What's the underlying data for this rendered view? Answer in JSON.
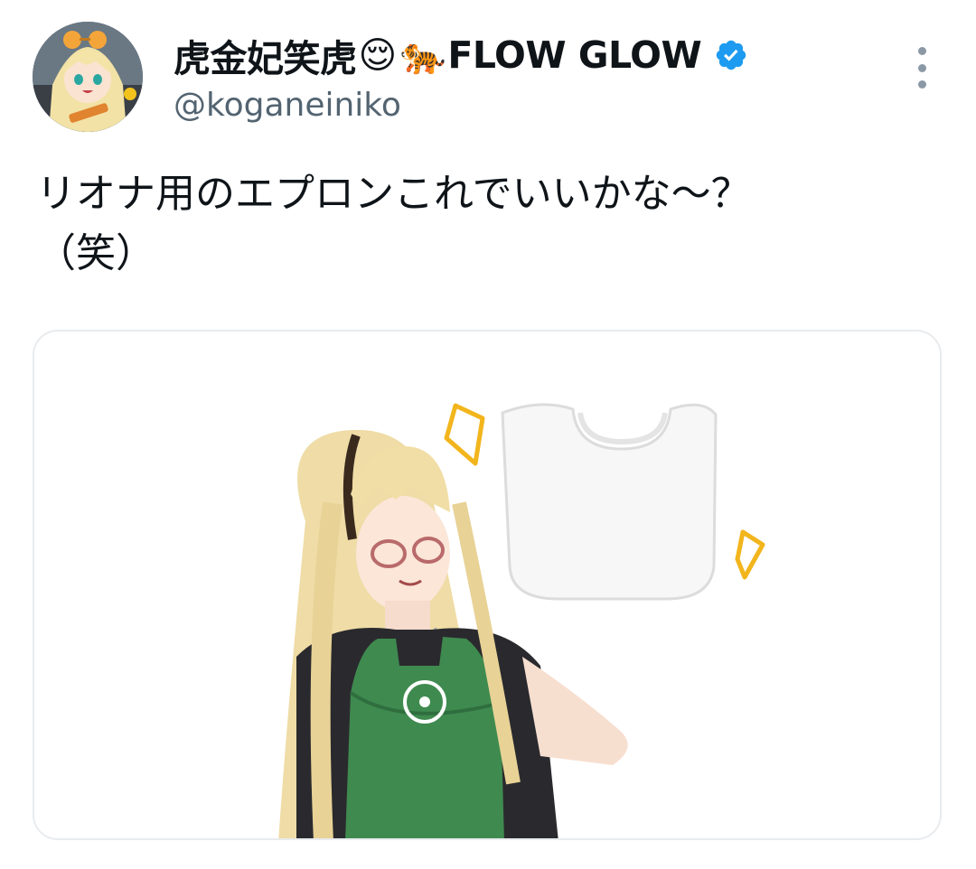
{
  "tweet": {
    "author": {
      "display_name_prefix": "虎金妃笑虎",
      "display_name_emoji_1": "😌",
      "display_name_emoji_2": "🐅",
      "display_name_suffix": "FLOW GLOW",
      "handle": "@koganeiniko",
      "verified": true,
      "verified_badge_color": "#1d9bf0",
      "avatar_icon": "avatar-icon"
    },
    "text": "リオナ用のエプロンこれでいいかな〜？\n（笑）",
    "more_icon": "more-options-icon",
    "media": {
      "description_icon": "tweet-image",
      "apron_color": "#3f8a4f",
      "sparkle_color": "#f2b51c"
    }
  }
}
